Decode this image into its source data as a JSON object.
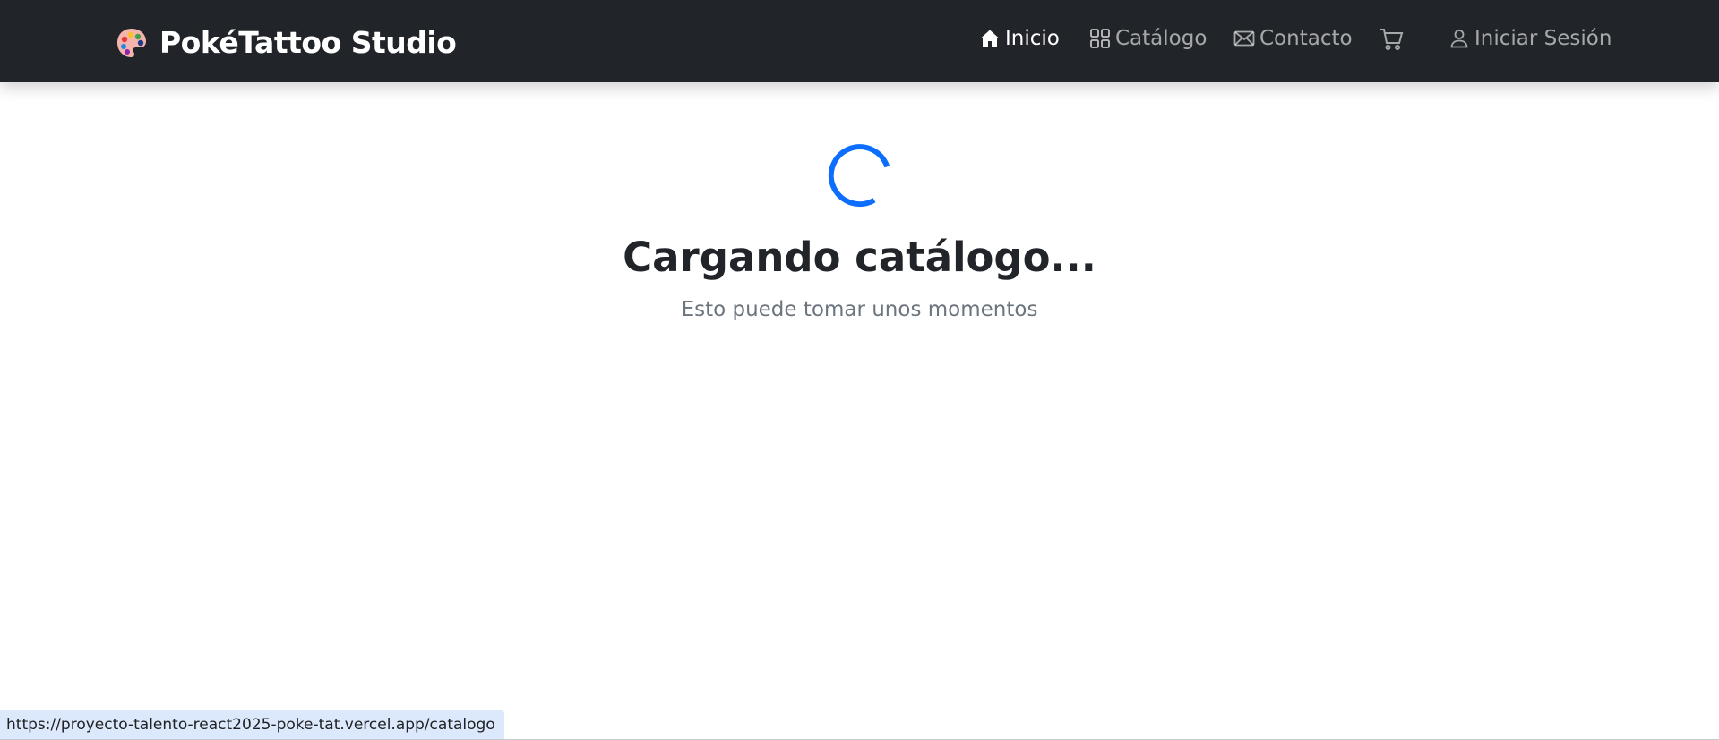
{
  "brand": {
    "icon": "palette-icon",
    "name": "PokéTattoo Studio"
  },
  "nav": {
    "items": [
      {
        "label": "Inicio",
        "icon": "house-fill-icon",
        "active": true
      },
      {
        "label": "Catálogo",
        "icon": "grid-icon",
        "active": false
      },
      {
        "label": "Contacto",
        "icon": "envelope-icon",
        "active": false
      },
      {
        "label": "",
        "icon": "cart-icon",
        "active": false
      },
      {
        "label": "Iniciar Sesión",
        "icon": "person-icon",
        "active": false
      }
    ]
  },
  "loading": {
    "title": "Cargando catálogo...",
    "subtitle": "Esto puede tomar unos momentos",
    "spinner_color": "#0d6efd"
  },
  "status_bar": {
    "url": "https://proyecto-talento-react2025-poke-tat.vercel.app/catalogo"
  },
  "colors": {
    "navbar_bg": "#212529",
    "accent": "#0d6efd"
  }
}
